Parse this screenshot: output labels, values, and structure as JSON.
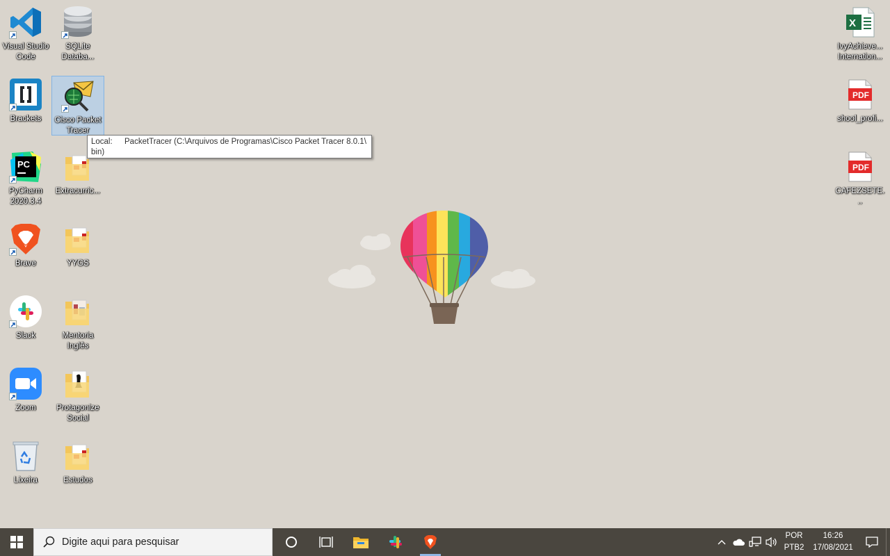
{
  "desktop": {
    "icons": [
      {
        "label": "Visual Studio Code"
      },
      {
        "label": "SQLite Databa..."
      },
      {
        "label": "Brackets"
      },
      {
        "label": "Cisco Packet Tracer"
      },
      {
        "label": "PyCharm 2020.3.4"
      },
      {
        "label": "Extracurric..."
      },
      {
        "label": "Brave"
      },
      {
        "label": "YYGS"
      },
      {
        "label": "Slack"
      },
      {
        "label": "Mentoria Inglês"
      },
      {
        "label": "Zoom"
      },
      {
        "label": "Protagonize Social"
      },
      {
        "label": "Lixeira"
      },
      {
        "label": "Estudos"
      },
      {
        "label": "IvyAchieve... Internation..."
      },
      {
        "label": "shool_profi..."
      },
      {
        "label": "CAFEZSETE..."
      }
    ],
    "tooltip": {
      "key": "Local:",
      "value": "PacketTracer (C:\\Arquivos de Programas\\Cisco Packet Tracer 8.0.1\\",
      "value_cont": "bin)"
    },
    "pdf_badge": "PDF"
  },
  "taskbar": {
    "search_placeholder": "Digite aqui para pesquisar",
    "language": "POR",
    "keyboard": "PTB2",
    "time": "16:26",
    "date": "17/08/2021"
  },
  "icons": {
    "start": "windows-logo-icon",
    "search": "magnifier-icon",
    "cortana": "cortana-circle-icon",
    "task_view": "task-view-icon",
    "explorer": "file-explorer-icon",
    "slack": "slack-icon",
    "brave": "brave-icon",
    "tray": [
      "chevron-up-icon",
      "onedrive-cloud-icon",
      "network-icon",
      "volume-icon"
    ],
    "notifications": "notification-icon"
  },
  "colors": {
    "desktop_bg": "#d9d4cc",
    "taskbar_bg": "#4a463f",
    "vscode": "#1f8ad2",
    "brave": "#f0521f",
    "zoom": "#2d8cff",
    "pdf_red": "#e32b2b"
  }
}
